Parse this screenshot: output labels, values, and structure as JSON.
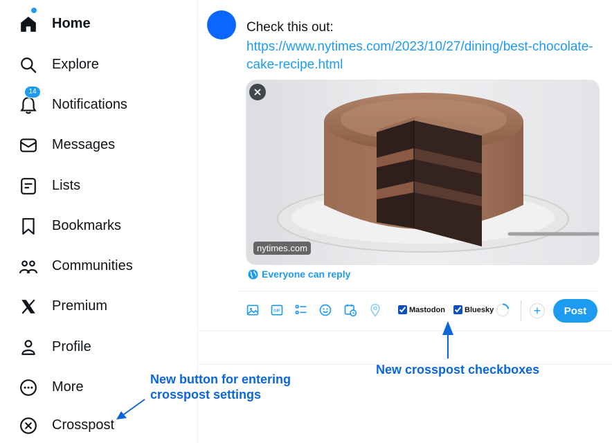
{
  "sidebar": {
    "items": [
      {
        "label": "Home",
        "icon": "home-icon"
      },
      {
        "label": "Explore",
        "icon": "search-icon"
      },
      {
        "label": "Notifications",
        "icon": "bell-icon",
        "badge": "14"
      },
      {
        "label": "Messages",
        "icon": "envelope-icon"
      },
      {
        "label": "Lists",
        "icon": "list-icon"
      },
      {
        "label": "Bookmarks",
        "icon": "bookmark-icon"
      },
      {
        "label": "Communities",
        "icon": "people-icon"
      },
      {
        "label": "Premium",
        "icon": "x-logo-icon"
      },
      {
        "label": "Profile",
        "icon": "person-icon"
      },
      {
        "label": "More",
        "icon": "more-circle-icon"
      },
      {
        "label": "Crosspost",
        "icon": "x-circle-icon"
      }
    ]
  },
  "compose": {
    "text": "Check this out:",
    "link": "https://www.nytimes.com/2023/10/27/dining/best-chocolate-cake-recipe.html",
    "media": {
      "domain": "nytimes.com",
      "description": "chocolate layer cake photo"
    },
    "reply_setting": "Everyone can reply",
    "crosspost": [
      {
        "label": "Mastodon",
        "checked": true
      },
      {
        "label": "Bluesky",
        "checked": true
      }
    ],
    "post_label": "Post",
    "accent": "#1d9bf0"
  },
  "annotations": {
    "crosspost_button_note": [
      "New button for entering",
      "crosspost settings"
    ],
    "checkbox_note": "New crosspost checkboxes",
    "color": "#0a66d9"
  }
}
